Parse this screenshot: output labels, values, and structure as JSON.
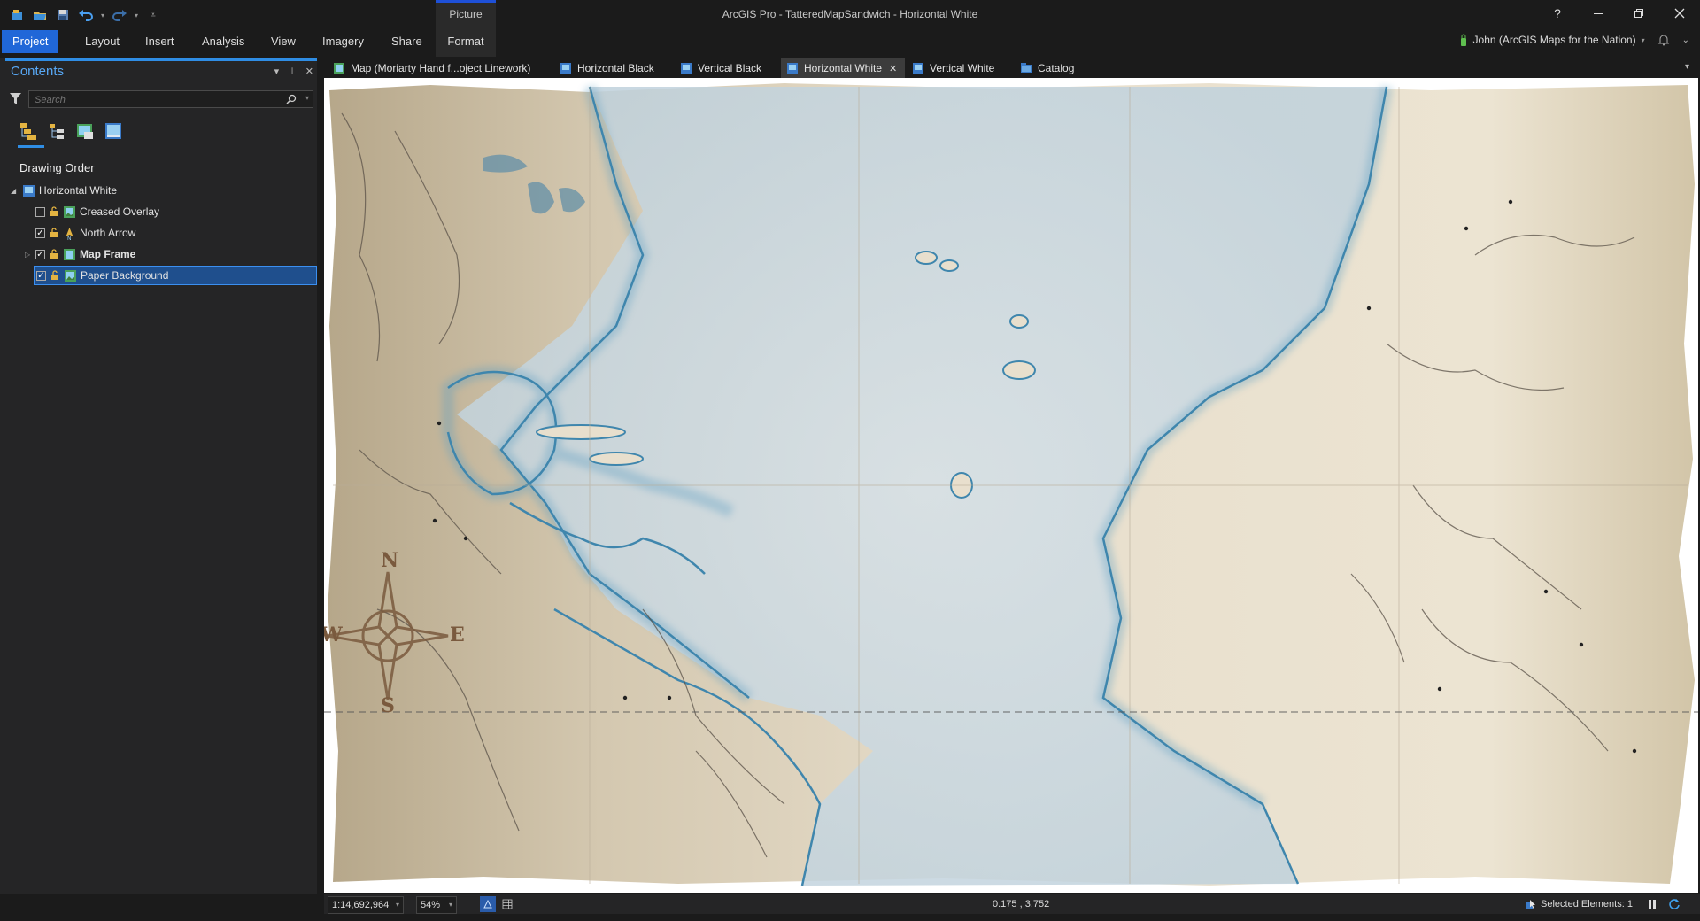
{
  "window": {
    "title": "ArcGIS Pro - TatteredMapSandwich - Horizontal White",
    "contextual_tab_group": "Picture"
  },
  "ribbon": {
    "tabs": [
      {
        "label": "Project",
        "active": true
      },
      {
        "label": "Layout"
      },
      {
        "label": "Insert"
      },
      {
        "label": "Analysis"
      },
      {
        "label": "View"
      },
      {
        "label": "Imagery"
      },
      {
        "label": "Share"
      },
      {
        "label": "Format",
        "contextual": true
      }
    ],
    "help": "?",
    "user": "John (ArcGIS Maps for the Nation)"
  },
  "contents": {
    "title": "Contents",
    "search_placeholder": "Search",
    "section": "Drawing Order",
    "tree": {
      "root": "Horizontal White",
      "items": [
        {
          "label": "Creased Overlay",
          "checked": false,
          "bold": false,
          "selected": false
        },
        {
          "label": "North Arrow",
          "checked": true,
          "bold": false,
          "selected": false
        },
        {
          "label": "Map Frame",
          "checked": true,
          "bold": true,
          "selected": false,
          "expandable": true
        },
        {
          "label": "Paper Background",
          "checked": true,
          "bold": false,
          "selected": true
        }
      ]
    }
  },
  "view_tabs": [
    {
      "label": "Map (Moriarty Hand f...oject Linework)",
      "icon": "map-icon"
    },
    {
      "label": "Horizontal Black",
      "icon": "layout-icon"
    },
    {
      "label": "Vertical Black",
      "icon": "layout-icon"
    },
    {
      "label": "Horizontal White",
      "icon": "layout-icon",
      "active": true,
      "closable": true
    },
    {
      "label": "Vertical White",
      "icon": "layout-icon"
    },
    {
      "label": "Catalog",
      "icon": "catalog-icon"
    }
  ],
  "map": {
    "compass": {
      "n": "N",
      "s": "S",
      "e": "E",
      "w": "W"
    }
  },
  "statusbar": {
    "scale": "1:14,692,964",
    "zoom": "54%",
    "coordinates": "0.175 , 3.752",
    "selected": "Selected Elements: 1"
  },
  "colors": {
    "accent": "#2067d8",
    "paper": "#e9dfc9",
    "ocean": "#cfdde6",
    "coast": "#3f86ad"
  }
}
